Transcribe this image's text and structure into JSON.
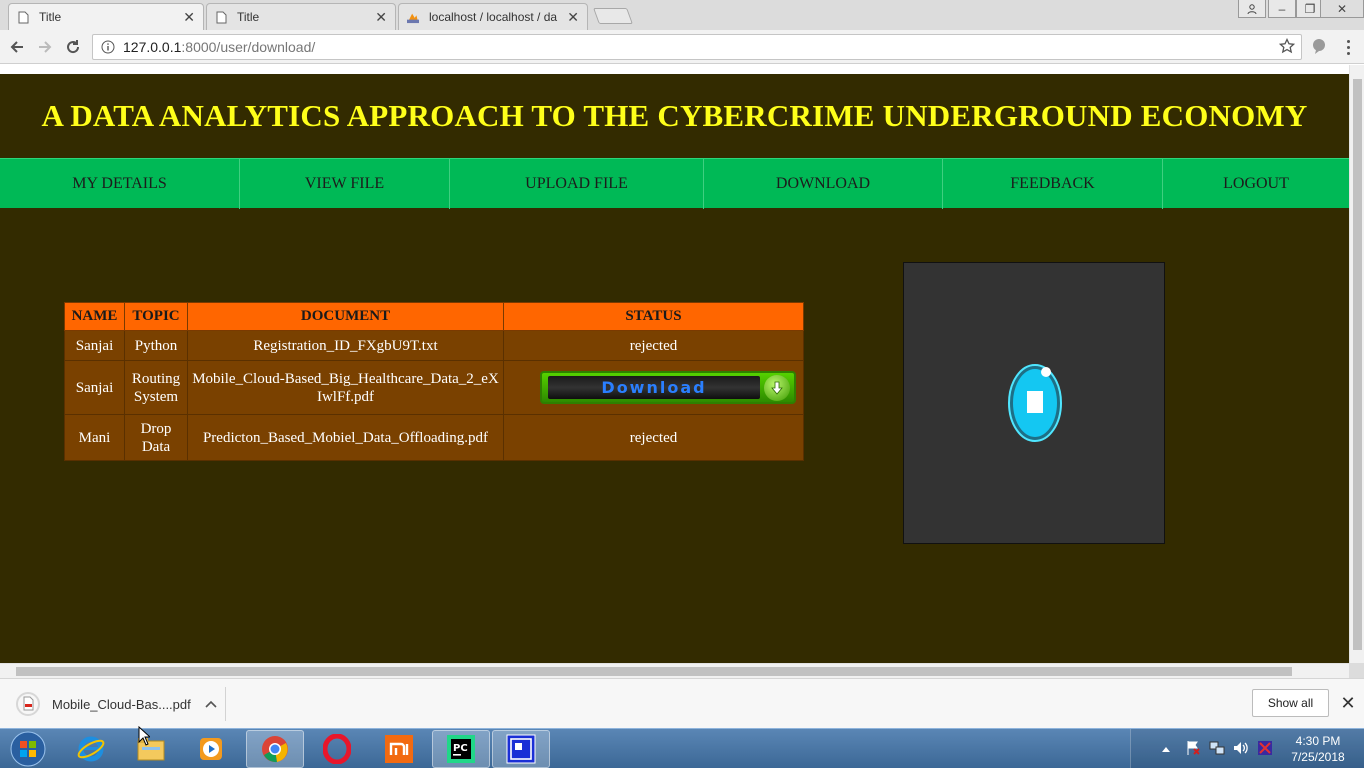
{
  "browser": {
    "tabs": [
      {
        "title": "Title",
        "active": true
      },
      {
        "title": "Title",
        "active": false
      },
      {
        "title": "localhost / localhost / da",
        "active": false
      }
    ],
    "url_host": "127.0.0.1",
    "url_path": ":8000/user/download/"
  },
  "site": {
    "title": "A DATA ANALYTICS APPROACH TO THE CYBERCRIME UNDERGROUND ECONOMY",
    "nav": [
      "MY DETAILS",
      "VIEW FILE",
      "UPLOAD FILE",
      "DOWNLOAD",
      "FEEDBACK",
      "LOGOUT"
    ]
  },
  "table": {
    "headers": [
      "NAME",
      "TOPIC",
      "DOCUMENT",
      "STATUS"
    ],
    "rows": [
      {
        "name": "Sanjai",
        "topic": "Python",
        "document": "Registration_ID_FXgbU9T.txt",
        "status": "rejected"
      },
      {
        "name": "Sanjai",
        "topic": "Routing System",
        "document": "Mobile_Cloud-Based_Big_Healthcare_Data_2_eXIwlFf.pdf",
        "status": "Download"
      },
      {
        "name": "Mani",
        "topic": "Drop Data",
        "document": "Predicton_Based_Mobiel_Data_Offloading.pdf",
        "status": "rejected"
      }
    ]
  },
  "download_shelf": {
    "file_name": "Mobile_Cloud-Bas....pdf",
    "show_all": "Show all"
  },
  "taskbar": {
    "time": "4:30 PM",
    "date": "7/25/2018"
  },
  "colors": {
    "page_bg": "#332b00",
    "title_yellow": "#ffff1a",
    "nav_green": "#00b956",
    "table_header": "#ff6600",
    "table_cell": "#7a4100"
  }
}
